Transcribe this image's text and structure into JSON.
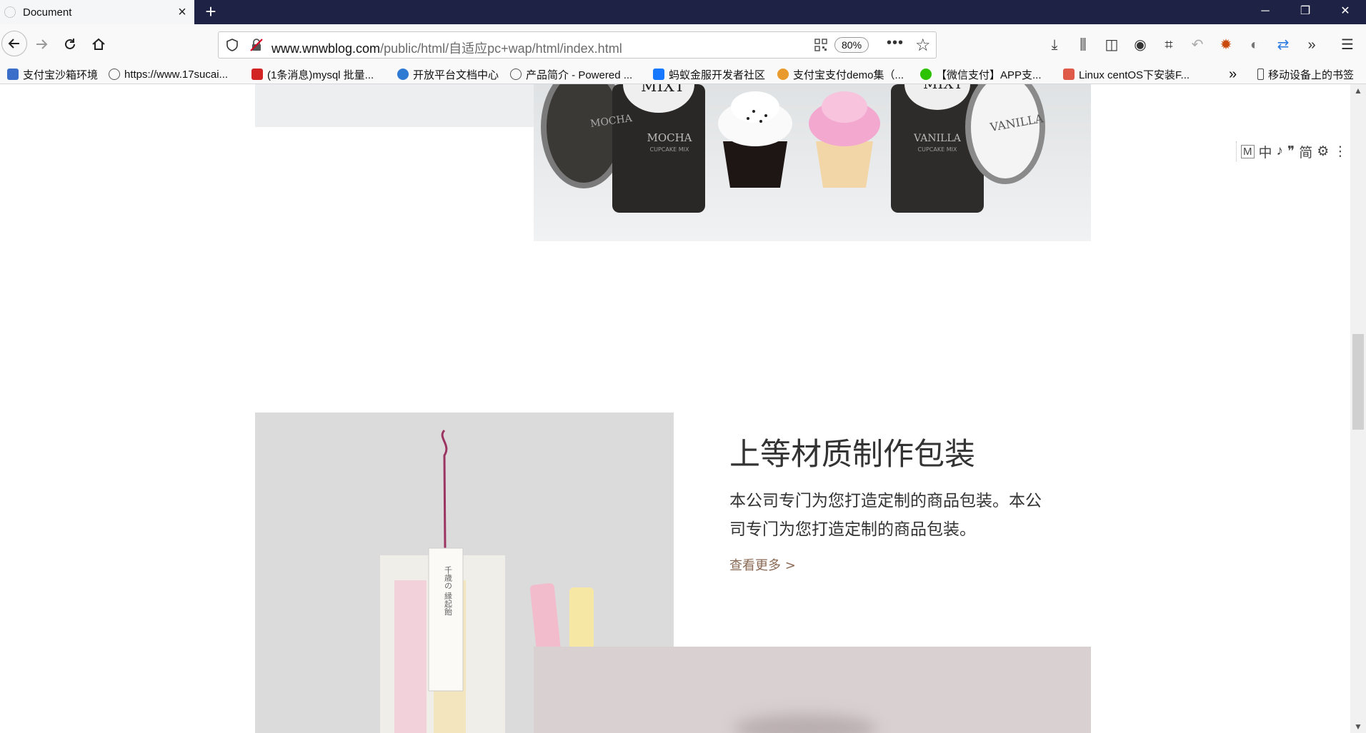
{
  "browser": {
    "tab_title": "Document",
    "new_tab": "+",
    "window_controls": {
      "minimize": "─",
      "restore": "❐",
      "close": "✕"
    },
    "url_host": "www.wnwblog.com",
    "url_path": "/public/html/自适应pc+wap/html/index.html",
    "zoom": "80%",
    "page_actions": "•••",
    "bookmark_star": "☆",
    "overflow": "»",
    "menu": "☰"
  },
  "bookmarks": [
    {
      "label": "支付宝沙箱环境",
      "icon": "shield-icon",
      "color": "#3b6ec9"
    },
    {
      "label": "https://www.17sucai...",
      "icon": "globe-icon",
      "color": "#666666"
    },
    {
      "label": "(1条消息)mysql 批量...",
      "icon": "csdn-icon",
      "color": "#d32424"
    },
    {
      "label": "开放平台文档中心",
      "icon": "person-icon",
      "color": "#2f7bd3"
    },
    {
      "label": "产品简介 - Powered ...",
      "icon": "globe-icon",
      "color": "#666666"
    },
    {
      "label": "蚂蚁金服开发者社区",
      "icon": "ant-icon",
      "color": "#1677ff"
    },
    {
      "label": "支付宝支付demo集（...",
      "icon": "cat-icon",
      "color": "#e89a2c"
    },
    {
      "label": "【微信支付】APP支...",
      "icon": "wechat-icon",
      "color": "#2dc100"
    },
    {
      "label": "Linux centOS下安装F...",
      "icon": "jian-icon",
      "color": "#e05a4a"
    }
  ],
  "bookmarks_more": "»",
  "mobile_bookmarks": "移动设备上的书签",
  "side_tool": [
    "M",
    "中",
    "♪",
    "❞",
    "简",
    "⚙",
    "⋮"
  ],
  "content": {
    "heading": "上等材质制作包装",
    "description": "本公司专门为您打造定制的商品包装。本公司专门为您打造定制的商品包装。",
    "more_link": "查看更多 >"
  },
  "images": {
    "top": {
      "labels": [
        "MIXT",
        "MOCHA",
        "MOCHA",
        "CUPCAKE MIX",
        "VANILLA",
        "CUPCAKE MIX",
        "VANILLA",
        "MIXT"
      ]
    },
    "candy_tag": "千歳の 縁起飴"
  }
}
